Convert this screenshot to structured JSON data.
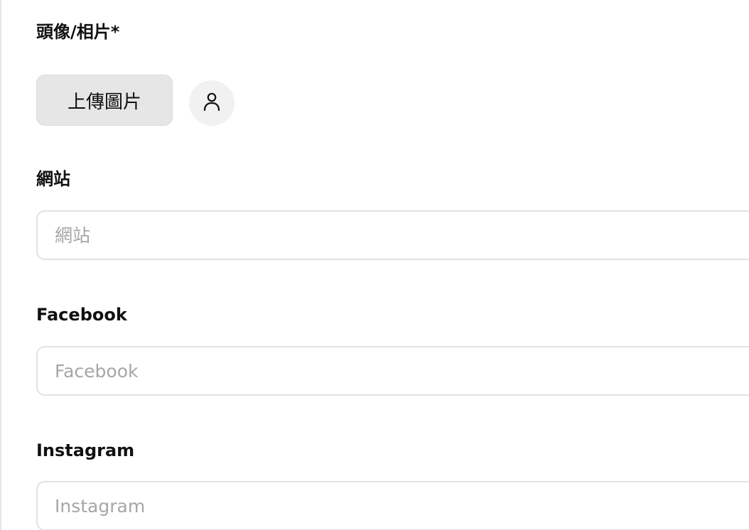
{
  "avatar_section": {
    "label": "頭像/相片*",
    "upload_button_label": "上傳圖片",
    "avatar_icon": "user-icon"
  },
  "website": {
    "label": "網站",
    "placeholder": "網站",
    "value": ""
  },
  "facebook": {
    "label": "Facebook",
    "placeholder": "Facebook",
    "value": ""
  },
  "instagram": {
    "label": "Instagram",
    "placeholder": "Instagram",
    "value": ""
  },
  "colors": {
    "button_bg": "#e6e6e6",
    "avatar_bg": "#f1f1f1",
    "input_border": "#e2e2e2",
    "placeholder": "#a6a6a6"
  }
}
